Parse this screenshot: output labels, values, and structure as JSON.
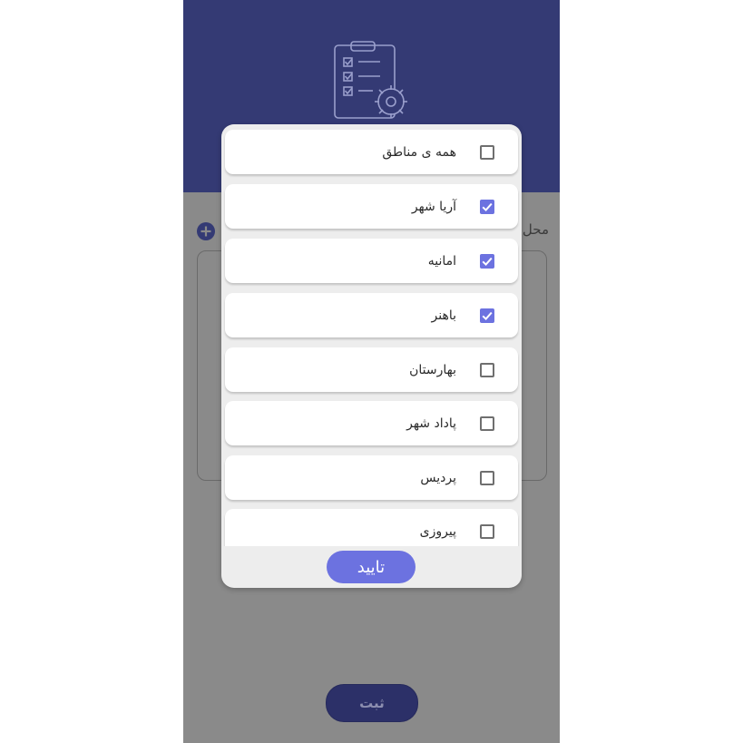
{
  "form": {
    "field_label": "محل",
    "submit_label": "ثبت"
  },
  "dialog": {
    "items": [
      {
        "label": "همه ی مناطق",
        "checked": false
      },
      {
        "label": "آریا شهر",
        "checked": true
      },
      {
        "label": "امانیه",
        "checked": true
      },
      {
        "label": "باهنر",
        "checked": true
      },
      {
        "label": "بهارستان",
        "checked": false
      },
      {
        "label": "پاداد شهر",
        "checked": false
      },
      {
        "label": "پردیس",
        "checked": false
      },
      {
        "label": "پیروزی",
        "checked": false
      }
    ],
    "confirm_label": "تایید"
  },
  "colors": {
    "header": "#343a74",
    "accent": "#6c72e0",
    "overlay_bg": "#8a8a8a",
    "dialog_bg": "#ededed"
  },
  "icons": {
    "header": "clipboard-checklist-gear-icon",
    "add": "add-circle-icon",
    "check": "check-icon"
  }
}
